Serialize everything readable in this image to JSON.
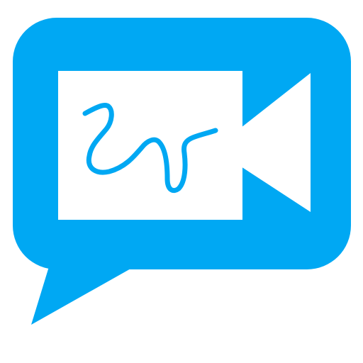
{
  "icon": {
    "name": "video-chat-signature-icon",
    "colors": {
      "brand": "#00a8f3",
      "background": "#ffffff",
      "camera_fill": "#ffffff"
    },
    "elements": [
      "chat-bubble-icon",
      "video-camera-icon",
      "signature-squiggle-icon"
    ]
  }
}
